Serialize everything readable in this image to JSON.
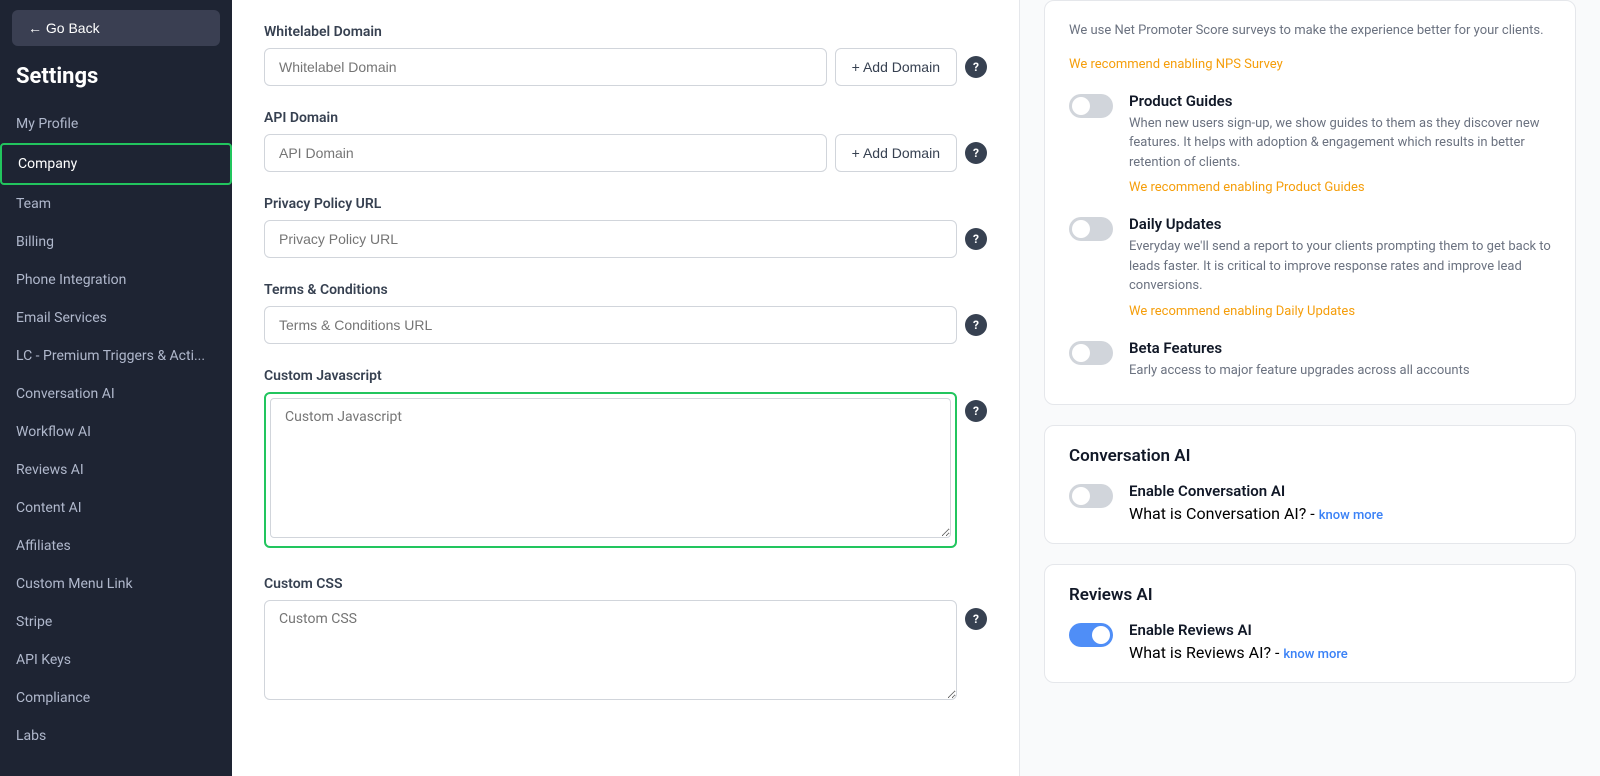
{
  "sidebar": {
    "go_back_label": "← Go Back",
    "title": "Settings",
    "items": [
      {
        "id": "my-profile",
        "label": "My Profile",
        "active": false
      },
      {
        "id": "company",
        "label": "Company",
        "active": true
      },
      {
        "id": "team",
        "label": "Team",
        "active": false
      },
      {
        "id": "billing",
        "label": "Billing",
        "active": false
      },
      {
        "id": "phone-integration",
        "label": "Phone Integration",
        "active": false
      },
      {
        "id": "email-services",
        "label": "Email Services",
        "active": false
      },
      {
        "id": "lc-premium",
        "label": "LC - Premium Triggers & Acti...",
        "active": false
      },
      {
        "id": "conversation-ai",
        "label": "Conversation AI",
        "active": false
      },
      {
        "id": "workflow-ai",
        "label": "Workflow AI",
        "active": false
      },
      {
        "id": "reviews-ai",
        "label": "Reviews AI",
        "active": false
      },
      {
        "id": "content-ai",
        "label": "Content AI",
        "active": false
      },
      {
        "id": "affiliates",
        "label": "Affiliates",
        "active": false
      },
      {
        "id": "custom-menu-link",
        "label": "Custom Menu Link",
        "active": false
      },
      {
        "id": "stripe",
        "label": "Stripe",
        "active": false
      },
      {
        "id": "api-keys",
        "label": "API Keys",
        "active": false
      },
      {
        "id": "compliance",
        "label": "Compliance",
        "active": false
      },
      {
        "id": "labs",
        "label": "Labs",
        "active": false
      }
    ]
  },
  "center": {
    "whitelabel_domain": {
      "label": "Whitelabel Domain",
      "placeholder": "Whitelabel Domain",
      "add_btn": "+ Add Domain"
    },
    "api_domain": {
      "label": "API Domain",
      "placeholder": "API Domain",
      "add_btn": "+ Add Domain"
    },
    "privacy_policy": {
      "label": "Privacy Policy URL",
      "placeholder": "Privacy Policy URL"
    },
    "terms_conditions": {
      "label": "Terms & Conditions",
      "placeholder": "Terms & Conditions URL"
    },
    "custom_javascript": {
      "label": "Custom Javascript",
      "placeholder": "Custom Javascript"
    },
    "custom_css": {
      "label": "Custom CSS",
      "placeholder": "Custom CSS"
    }
  },
  "right": {
    "nps_top_text": "We use Net Promoter Score surveys to make the experience better for your clients.",
    "nps_recommend": "We recommend enabling NPS Survey",
    "product_guides": {
      "title": "Product Guides",
      "description": "When new users sign-up, we show guides to them as they discover new features. It helps with adoption & engagement which results in better retention of clients.",
      "recommend": "We recommend enabling Product Guides",
      "on": false
    },
    "daily_updates": {
      "title": "Daily Updates",
      "description": "Everyday we'll send a report to your clients prompting them to get back to leads faster. It is critical to improve response rates and improve lead conversions.",
      "recommend": "We recommend enabling Daily Updates",
      "on": false
    },
    "beta_features": {
      "title": "Beta Features",
      "description": "Early access to major feature upgrades across all accounts",
      "on": false
    },
    "conversation_ai_card": {
      "title": "Conversation AI",
      "enable_label": "Enable Conversation AI",
      "desc_text": "What is Conversation AI? -",
      "know_more": "know more",
      "on": false
    },
    "reviews_ai_card": {
      "title": "Reviews AI",
      "enable_label": "Enable Reviews AI",
      "desc_text": "What is Reviews AI? -",
      "know_more": "know more",
      "on": true
    }
  }
}
